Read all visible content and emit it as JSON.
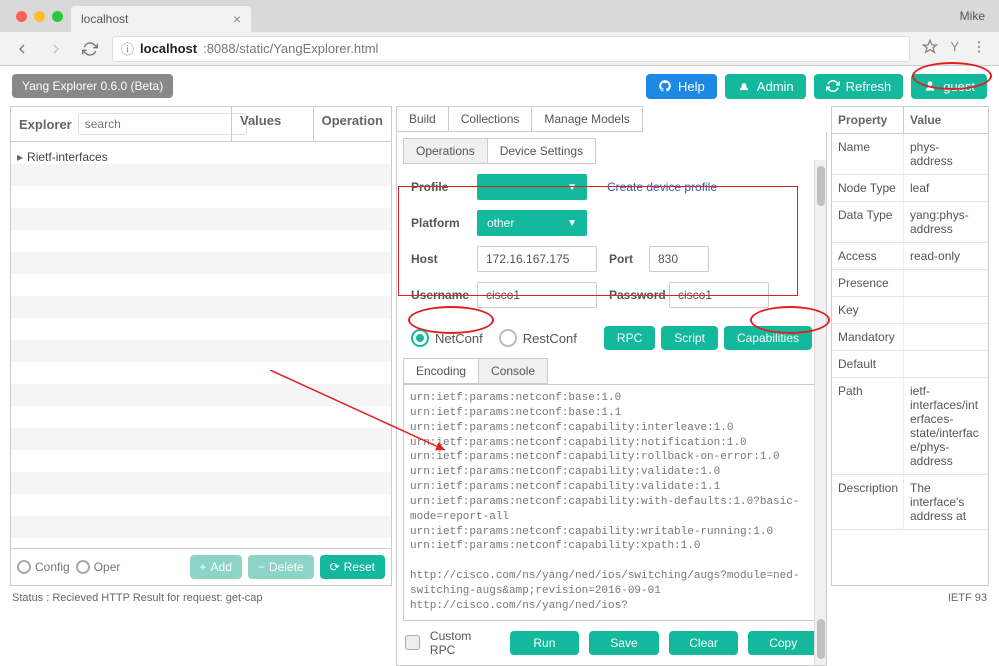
{
  "browser": {
    "tab_title": "localhost",
    "user": "Mike",
    "url_host": "localhost",
    "url_rest": ":8088/static/YangExplorer.html"
  },
  "appbar": {
    "title": "Yang Explorer 0.6.0 (Beta)",
    "help": "Help",
    "admin": "Admin",
    "refresh": "Refresh",
    "guest": "guest"
  },
  "explorer": {
    "head_explorer": "Explorer",
    "head_values": "Values",
    "head_operation": "Operation",
    "search_placeholder": "search",
    "tree_item": "Rietf-interfaces",
    "config": "Config",
    "oper": "Oper",
    "add": "Add",
    "delete": "Delete",
    "reset": "Reset"
  },
  "center": {
    "tabs": {
      "build": "Build",
      "collections": "Collections",
      "manage": "Manage Models"
    },
    "subtabs": {
      "operations": "Operations",
      "device_settings": "Device Settings"
    },
    "form": {
      "profile_label": "Profile",
      "create_profile": "Create device profile",
      "platform_label": "Platform",
      "platform_value": "other",
      "host_label": "Host",
      "host_value": "172.16.167.175",
      "port_label": "Port",
      "port_value": "830",
      "user_label": "Username",
      "user_value": "cisco1",
      "pass_label": "Password",
      "pass_value": "cisco1"
    },
    "conn": {
      "netconf": "NetConf",
      "restconf": "RestConf",
      "rpc": "RPC",
      "script": "Script",
      "caps": "Capabilities"
    },
    "subtabs2": {
      "encoding": "Encoding",
      "console": "Console"
    },
    "console_text": "urn:ietf:params:netconf:base:1.0\nurn:ietf:params:netconf:base:1.1\nurn:ietf:params:netconf:capability:interleave:1.0\nurn:ietf:params:netconf:capability:notification:1.0\nurn:ietf:params:netconf:capability:rollback-on-error:1.0\nurn:ietf:params:netconf:capability:validate:1.0\nurn:ietf:params:netconf:capability:validate:1.1\nurn:ietf:params:netconf:capability:with-defaults:1.0?basic-mode=report-all\nurn:ietf:params:netconf:capability:writable-running:1.0\nurn:ietf:params:netconf:capability:xpath:1.0\n\nhttp://cisco.com/ns/yang/ned/ios/switching/augs?module=ned-switching-augs&amp;revision=2016-09-01\nhttp://cisco.com/ns/yang/ned/ios?",
    "runrow": {
      "custom": "Custom RPC",
      "run": "Run",
      "save": "Save",
      "clear": "Clear",
      "copy": "Copy"
    }
  },
  "props": {
    "head_prop": "Property",
    "head_val": "Value",
    "rows": [
      {
        "p": "Name",
        "v": "phys-address"
      },
      {
        "p": "Node Type",
        "v": "leaf"
      },
      {
        "p": "Data Type",
        "v": "yang:phys-address"
      },
      {
        "p": "Access",
        "v": "read-only"
      },
      {
        "p": "Presence",
        "v": ""
      },
      {
        "p": "Key",
        "v": ""
      },
      {
        "p": "Mandatory",
        "v": ""
      },
      {
        "p": "Default",
        "v": ""
      },
      {
        "p": "Path",
        "v": "ietf-interfaces/interfaces-state/interface/phys-address"
      },
      {
        "p": "Description",
        "v": "The interface's address at"
      }
    ]
  },
  "status": {
    "text": "Status : Recieved HTTP Result for request: get-cap",
    "right": "IETF 93"
  }
}
